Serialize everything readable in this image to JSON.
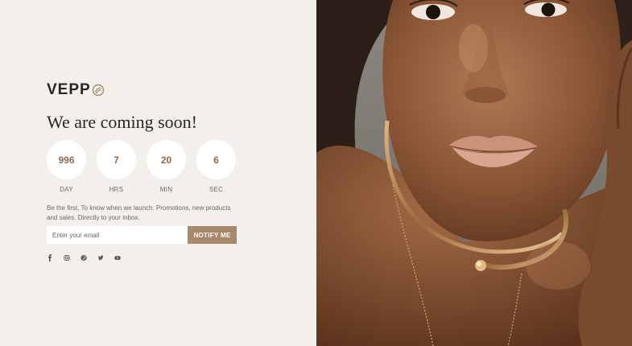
{
  "brand": {
    "name": "VEPP",
    "accent_color": "#a8896d"
  },
  "hero": {
    "headline": "We are coming soon!"
  },
  "countdown": {
    "units": [
      {
        "value": "996",
        "label": "DAY"
      },
      {
        "value": "7",
        "label": "HRS"
      },
      {
        "value": "20",
        "label": "MIN"
      },
      {
        "value": "6",
        "label": "SEC"
      }
    ]
  },
  "signup": {
    "blurb": "Be the first, To know when we launch. Promotions, new products and sales. Directly to your inbox.",
    "email_placeholder": "Enter your email",
    "button_label": "NOTIFY ME"
  },
  "social": {
    "icons": [
      "facebook-icon",
      "instagram-icon",
      "pinterest-icon",
      "twitter-icon",
      "youtube-icon"
    ]
  },
  "photo": {
    "subject": "woman-with-gold-necklace-photo"
  }
}
